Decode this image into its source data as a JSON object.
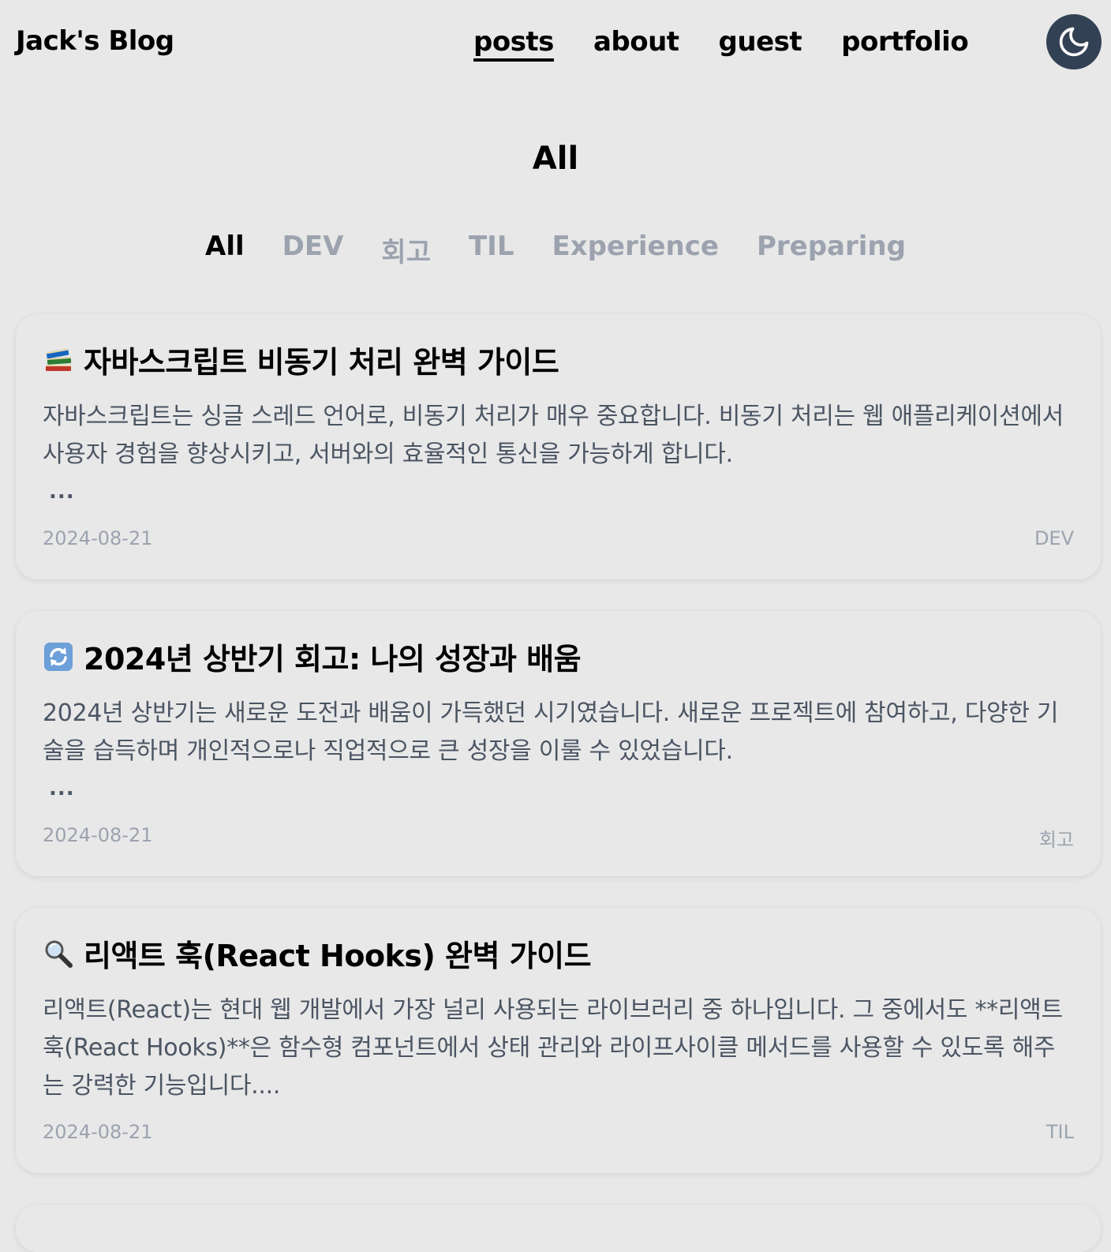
{
  "header": {
    "brand": "Jack's Blog",
    "nav": [
      {
        "label": "posts",
        "active": true
      },
      {
        "label": "about",
        "active": false
      },
      {
        "label": "guest",
        "active": false
      },
      {
        "label": "portfolio",
        "active": false
      }
    ],
    "theme_toggle_icon": "moon-icon"
  },
  "main": {
    "title": "All",
    "categories": [
      {
        "label": "All",
        "active": true
      },
      {
        "label": "DEV",
        "active": false
      },
      {
        "label": "회고",
        "active": false
      },
      {
        "label": "TIL",
        "active": false
      },
      {
        "label": "Experience",
        "active": false
      },
      {
        "label": "Preparing",
        "active": false
      }
    ],
    "posts": [
      {
        "icon": "books-icon",
        "title": "자바스크립트 비동기 처리 완벽 가이드",
        "excerpt": "자바스크립트는 싱글 스레드 언어로, 비동기 처리가 매우 중요합니다. 비동기 처리는 웹 애플리케이션에서 사용자 경험을 향상시키고, 서버와의 효율적인 통신을 가능하게 합니다.",
        "ellipsis": "...",
        "date": "2024-08-21",
        "tag": "DEV"
      },
      {
        "icon": "refresh-icon",
        "title": "2024년 상반기 회고: 나의 성장과 배움",
        "excerpt": "2024년 상반기는 새로운 도전과 배움이 가득했던 시기였습니다. 새로운 프로젝트에 참여하고, 다양한 기술을 습득하며 개인적으로나 직업적으로 큰 성장을 이룰 수 있었습니다.",
        "ellipsis": "...",
        "date": "2024-08-21",
        "tag": "회고"
      },
      {
        "icon": "magnifier-icon",
        "title": "리액트 훅(React Hooks) 완벽 가이드",
        "excerpt": "리액트(React)는 현대 웹 개발에서 가장 널리 사용되는 라이브러리 중 하나입니다. 그 중에서도 **리액트 훅(React Hooks)**은 함수형 컴포넌트에서 상태 관리와 라이프사이클 메서드를 사용할 수 있도록 해주는 강력한 기능입니다....",
        "date": "2024-08-21",
        "tag": "TIL"
      }
    ]
  }
}
